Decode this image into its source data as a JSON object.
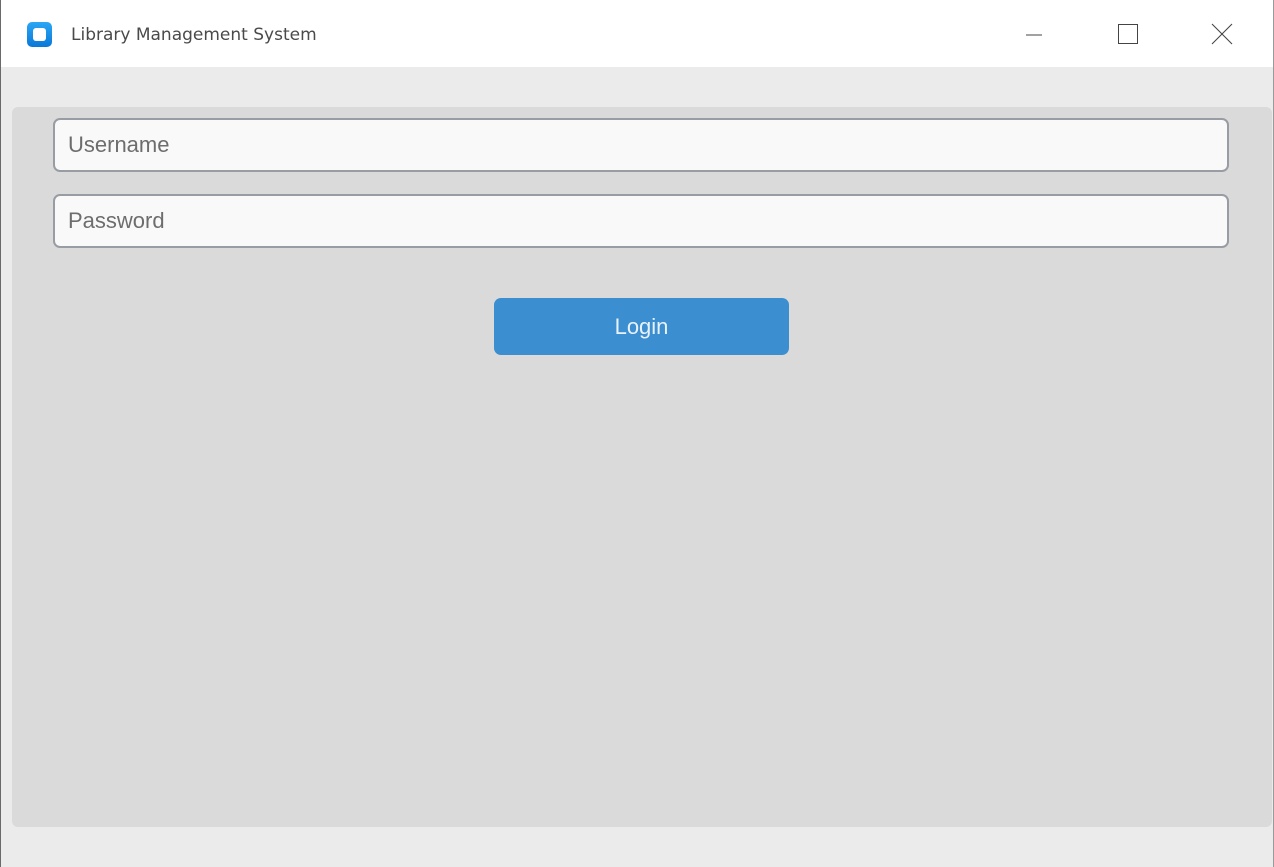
{
  "window": {
    "title": "Library Management System",
    "icon": "app-window-icon",
    "controls": {
      "minimize_icon": "minimize-icon",
      "maximize_icon": "maximize-icon",
      "close_icon": "close-icon"
    }
  },
  "login_form": {
    "username": {
      "value": "",
      "placeholder": "Username"
    },
    "password": {
      "value": "",
      "placeholder": "Password"
    },
    "login_label": "Login"
  },
  "colors": {
    "accent": "#3b8ed0",
    "content_bg": "#dadada",
    "window_bg": "#ebebeb"
  }
}
